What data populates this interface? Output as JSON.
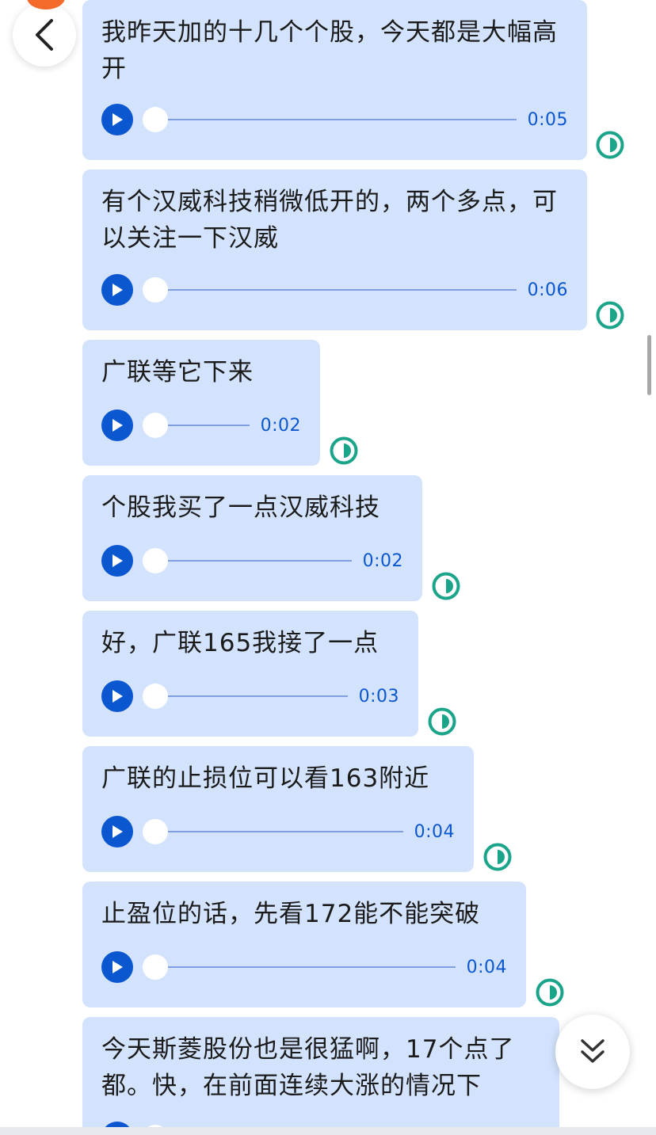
{
  "messages": [
    {
      "text": "我昨天加的十几个个股，今天都是大幅高开",
      "duration": "0:05",
      "progress": 0
    },
    {
      "text": "有个汉威科技稍微低开的，两个多点，可以关注一下汉威",
      "duration": "0:06",
      "progress": 0
    },
    {
      "text": "广联等它下来",
      "duration": "0:02",
      "progress": 0
    },
    {
      "text": "个股我买了一点汉威科技",
      "duration": "0:02",
      "progress": 0
    },
    {
      "text": "好，广联165我接了一点",
      "duration": "0:03",
      "progress": 0
    },
    {
      "text": "广联的止损位可以看163附近",
      "duration": "0:04",
      "progress": 0
    },
    {
      "text": "止盈位的话，先看172能不能突破",
      "duration": "0:04",
      "progress": 0
    },
    {
      "text": "今天斯菱股份也是很猛啊，17个点了都。快，在前面连续大涨的情况下",
      "duration": "",
      "progress": 0
    }
  ],
  "icons": {
    "back": "chevron-left-icon",
    "play": "play-icon",
    "status": "half-circle-status-icon",
    "scroll_down": "double-chevron-down-icon"
  },
  "colors": {
    "bubble": "#d3e3fd",
    "accent": "#0b57d0",
    "status": "#1aa58a"
  }
}
